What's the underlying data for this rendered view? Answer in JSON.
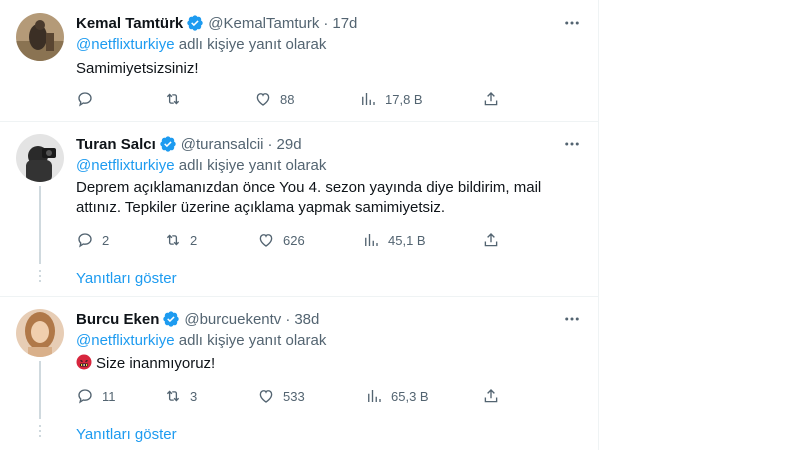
{
  "colors": {
    "accent": "#1d9bf0",
    "muted": "#536471",
    "text": "#0f1419",
    "border": "#eff3f4"
  },
  "tweets": [
    {
      "name": "Kemal Tamtürk",
      "handle": "@KemalTamturk",
      "dot": "·",
      "time": "17d",
      "mention": "@netflixturkiye",
      "replying_suffix": " adlı kişiye yanıt olarak",
      "text": "Samimiyetsizsiniz!",
      "replies": "",
      "retweets": "",
      "likes": "88",
      "views": "17,8 B"
    },
    {
      "name": "Turan Salcı",
      "handle": "@turansalcii",
      "dot": "·",
      "time": "29d",
      "mention": "@netflixturkiye",
      "replying_suffix": " adlı kişiye yanıt olarak",
      "text_line1": "Deprem açıklamanızdan önce You 4. sezon yayında diye bildirim, mail",
      "text_line2": "attınız. Tepkiler üzerine açıklama yapmak samimiyetsiz.",
      "replies": "2",
      "retweets": "2",
      "likes": "626",
      "views": "45,1 B",
      "show_replies": "Yanıtları göster"
    },
    {
      "name": "Burcu Eken",
      "handle": "@burcuekentv",
      "dot": "·",
      "time": "38d",
      "mention": "@netflixturkiye",
      "replying_suffix": " adlı kişiye yanıt olarak",
      "emoji": "face-with-symbols-on-mouth",
      "text": "Size inanmıyoruz!",
      "replies": "11",
      "retweets": "3",
      "likes": "533",
      "views": "65,3 B",
      "show_replies": "Yanıtları göster"
    }
  ]
}
